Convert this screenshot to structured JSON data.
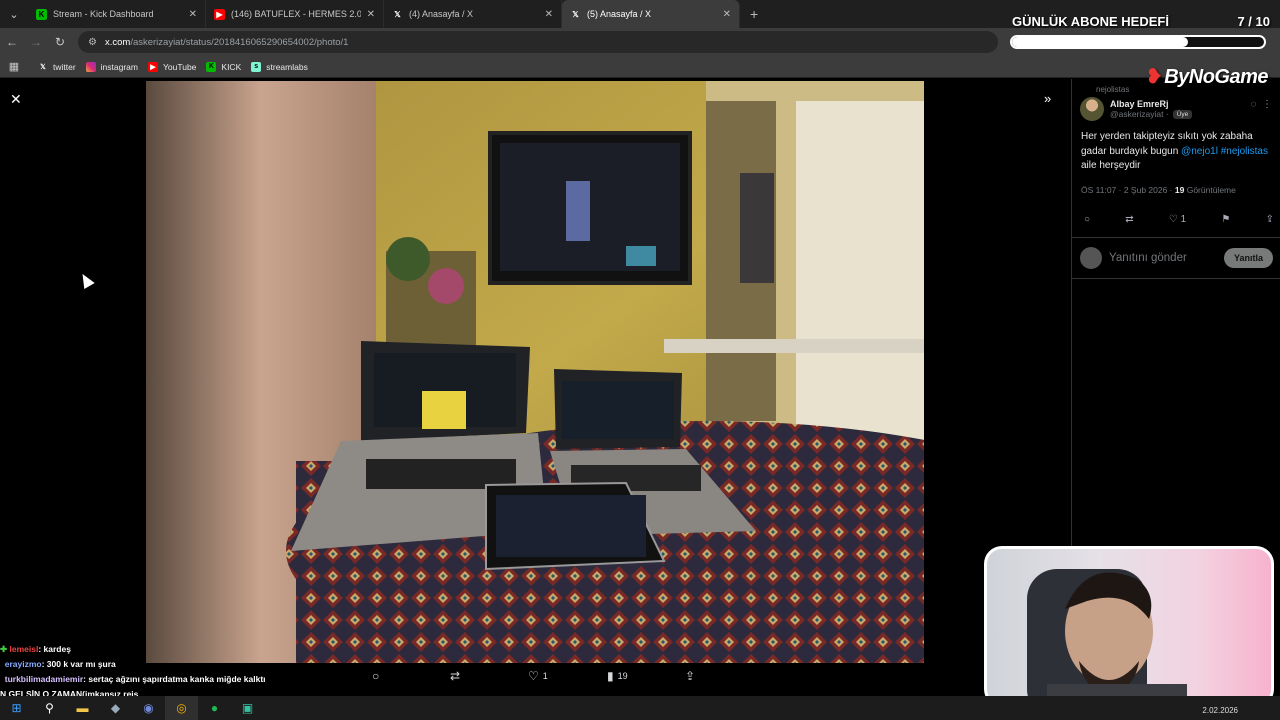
{
  "browser": {
    "tabs": [
      {
        "title": "Stream - Kick Dashboard",
        "favicon": "kick-icon",
        "active": false
      },
      {
        "title": "(146) BATUFLEX - HERMES 2.0",
        "favicon": "youtube-icon",
        "active": false
      },
      {
        "title": "(4) Anasayfa / X",
        "favicon": "x-icon",
        "active": false
      },
      {
        "title": "(5) Anasayfa / X",
        "favicon": "x-icon",
        "active": true
      }
    ],
    "new_tab": "+",
    "url_host": "x.com",
    "url_path": "/askerizayiat/status/2018416065290654002/photo/1",
    "bookmarks": [
      {
        "label": "twitter",
        "icon": "x-icon"
      },
      {
        "label": "instagram",
        "icon": "instagram-icon"
      },
      {
        "label": "YouTube",
        "icon": "youtube-icon"
      },
      {
        "label": "KICK",
        "icon": "kick-icon"
      },
      {
        "label": "streamlabs",
        "icon": "streamlabs-icon"
      }
    ]
  },
  "overlay": {
    "goal_title": "GÜNLÜK ABONE HEDEFİ",
    "goal_count": "7 / 10",
    "goal_progress": 0.7,
    "sponsor": "ByNoGame"
  },
  "viewer": {
    "actions": {
      "reply_count": "",
      "repost_count": "",
      "like_count": "1",
      "views_count": "19"
    }
  },
  "tweet": {
    "pinned_label": "nejolistas",
    "display_name": "Albay EmreRj",
    "handle": "@askerizayiat ·",
    "badge": "Üye",
    "text_part1": "Her yerden takipteyiz sıkıtı yok zabaha gadar burdayık bugun ",
    "mention": "@nejo1l",
    "hashtag": "#nejolistas",
    "text_part2": " aile herşeydir",
    "time": "ÖS 11:07 · 2 Şub 2026 ·",
    "views_num": "19",
    "views_label": " Görüntüleme",
    "like_count": "1",
    "reply_placeholder": "Yanıtını gönder",
    "reply_button": "Yanıtla"
  },
  "chat": [
    {
      "user": "lemeisl",
      "message": ": kardeş"
    },
    {
      "user": "erayizmo",
      "message": ": 300 k var mı şura"
    },
    {
      "user": "turkbilimadamiemir",
      "message": ": sertaç ağzını şapırdatma kanka miğde kalktı"
    },
    {
      "user": "",
      "message": "N GELSİN O ZAMAN(imkansız reis"
    }
  ],
  "taskbar": {
    "date": "2.02.2026"
  }
}
